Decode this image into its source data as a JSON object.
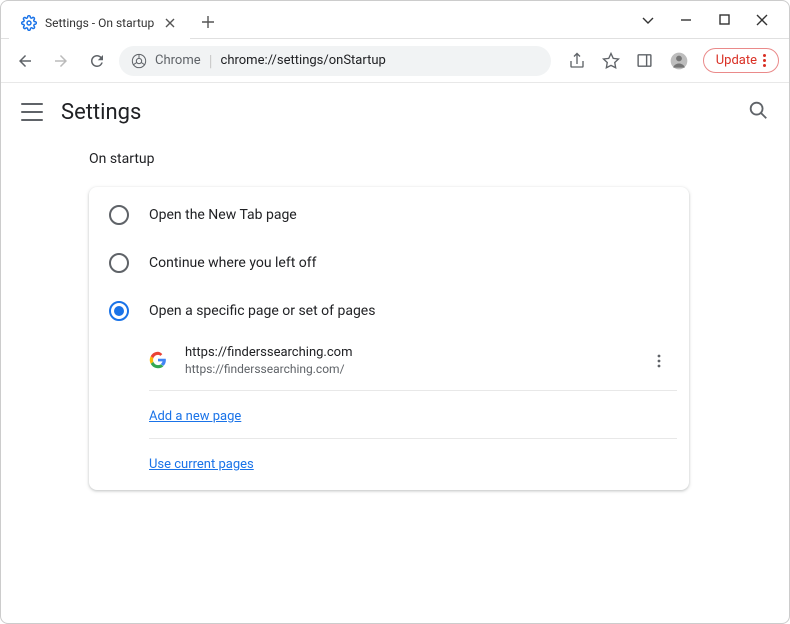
{
  "tab": {
    "title": "Settings - On startup"
  },
  "omnibox": {
    "prefix": "Chrome",
    "path": "chrome://settings/onStartup"
  },
  "update_label": "Update",
  "settings": {
    "title": "Settings",
    "section_title": "On startup",
    "options": {
      "new_tab": "Open the New Tab page",
      "continue": "Continue where you left off",
      "specific": "Open a specific page or set of pages"
    },
    "page_entry": {
      "title": "https://finderssearching.com",
      "url": "https://finderssearching.com/"
    },
    "add_page": "Add a new page",
    "use_current": "Use current pages"
  }
}
